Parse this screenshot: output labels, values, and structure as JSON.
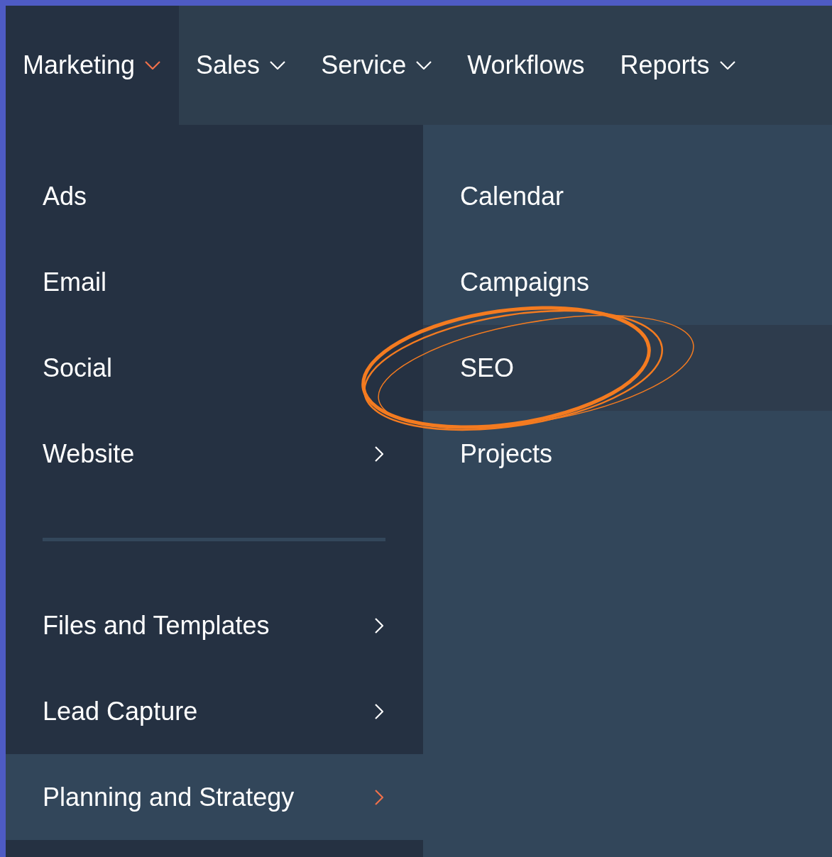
{
  "nav": {
    "tabs": [
      {
        "label": "Marketing",
        "selected": true,
        "has_caret": true
      },
      {
        "label": "Sales",
        "selected": false,
        "has_caret": true
      },
      {
        "label": "Service",
        "selected": false,
        "has_caret": true
      },
      {
        "label": "Workflows",
        "selected": false,
        "has_caret": false
      },
      {
        "label": "Reports",
        "selected": false,
        "has_caret": true
      }
    ]
  },
  "menu": {
    "items": [
      {
        "kind": "item",
        "label": "Ads",
        "has_submenu": false,
        "selected": false
      },
      {
        "kind": "item",
        "label": "Email",
        "has_submenu": false,
        "selected": false
      },
      {
        "kind": "item",
        "label": "Social",
        "has_submenu": false,
        "selected": false
      },
      {
        "kind": "item",
        "label": "Website",
        "has_submenu": true,
        "selected": false
      },
      {
        "kind": "divider"
      },
      {
        "kind": "item",
        "label": "Files and Templates",
        "has_submenu": true,
        "selected": false
      },
      {
        "kind": "item",
        "label": "Lead Capture",
        "has_submenu": true,
        "selected": false
      },
      {
        "kind": "item",
        "label": "Planning and Strategy",
        "has_submenu": true,
        "selected": true
      }
    ]
  },
  "submenu": {
    "items": [
      {
        "label": "Calendar",
        "selected": false
      },
      {
        "label": "Campaigns",
        "selected": false
      },
      {
        "label": "SEO",
        "selected": true
      },
      {
        "label": "Projects",
        "selected": false
      }
    ]
  },
  "annotation": {
    "kind": "ellipse"
  }
}
